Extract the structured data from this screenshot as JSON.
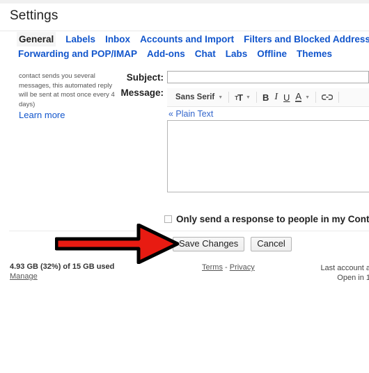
{
  "header": {
    "title": "Settings"
  },
  "tabs": {
    "row1": [
      {
        "label": "General",
        "active": true
      },
      {
        "label": "Labels",
        "active": false
      },
      {
        "label": "Inbox",
        "active": false
      },
      {
        "label": "Accounts and Import",
        "active": false
      },
      {
        "label": "Filters and Blocked Addresses",
        "active": false
      }
    ],
    "row2": [
      {
        "label": "Forwarding and POP/IMAP",
        "active": false
      },
      {
        "label": "Add-ons",
        "active": false
      },
      {
        "label": "Chat",
        "active": false
      },
      {
        "label": "Labs",
        "active": false
      },
      {
        "label": "Offline",
        "active": false
      },
      {
        "label": "Themes",
        "active": false
      }
    ]
  },
  "side_note": {
    "text": "contact sends you several messages, this automated reply will be sent at most once every 4 days)",
    "learn_more": "Learn more"
  },
  "form": {
    "subject_label": "Subject:",
    "subject_value": "",
    "subject_placeholder": "",
    "message_label": "Message:"
  },
  "editor": {
    "font_name": "Sans Serif",
    "font_caret": "▾",
    "size_icon": "ᴛT",
    "size_caret": "▾",
    "bold": "B",
    "italic": "I",
    "underline": "U",
    "text_color": "A",
    "color_caret": "▾",
    "link_icon": "link-icon",
    "plain_text": "« Plain Text",
    "message_value": ""
  },
  "options": {
    "contacts_only_label": "Only send a response to people in my Contact"
  },
  "buttons": {
    "save": "Save Changes",
    "cancel": "Cancel"
  },
  "footer": {
    "storage_used": "4.93 GB (32%) of 15 GB used",
    "manage": "Manage",
    "terms": "Terms",
    "terms_separator": "-",
    "privacy": "Privacy",
    "last_account_line1": "Last account a",
    "last_account_line2": "Open in 1"
  },
  "annotation": {
    "type": "red-arrow",
    "points_to": "Save Changes",
    "fill_color": "#e81b12",
    "stroke_color": "#000000"
  }
}
